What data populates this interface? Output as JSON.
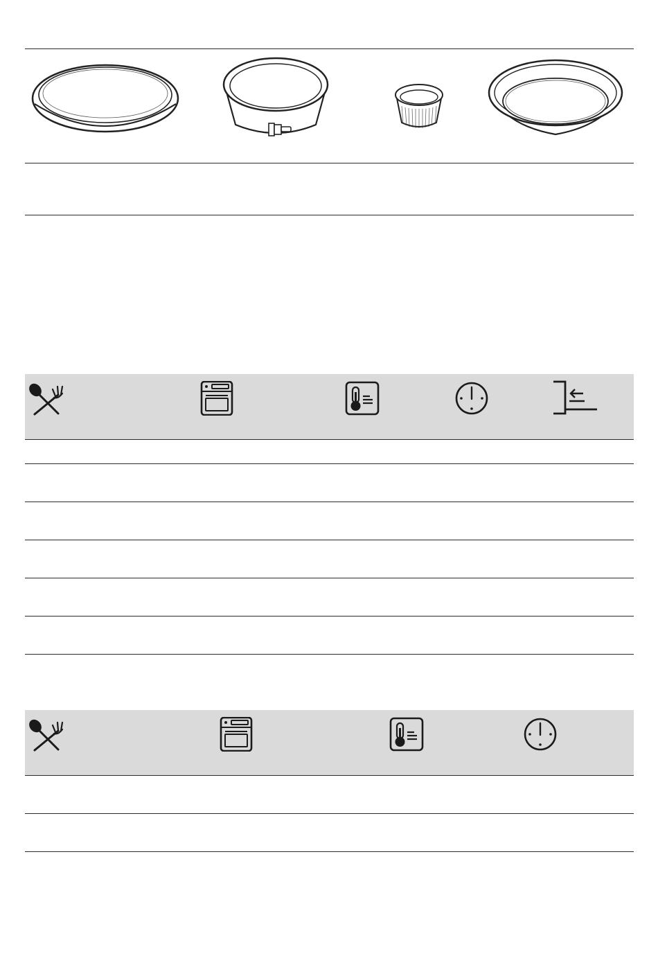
{
  "bakeware": {
    "items": [
      {
        "icon": "flat-pizza-pan-icon"
      },
      {
        "icon": "springform-cake-tin-icon"
      },
      {
        "icon": "ramekin-icon"
      },
      {
        "icon": "deep-flan-dish-icon"
      }
    ],
    "row_values": [
      "",
      "",
      "",
      ""
    ]
  },
  "table_1": {
    "header_icons": [
      "cutlery-icon",
      "oven-function-icon",
      "temperature-icon",
      "clock-icon",
      "shelf-level-icon"
    ],
    "rows": [
      [
        "",
        "",
        "",
        "",
        ""
      ],
      [
        "",
        "",
        "",
        "",
        ""
      ],
      [
        "",
        "",
        "",
        "",
        ""
      ],
      [
        "",
        "",
        "",
        "",
        ""
      ],
      [
        "",
        "",
        "",
        "",
        ""
      ],
      [
        "",
        "",
        "",
        "",
        ""
      ]
    ]
  },
  "table_2": {
    "header_icons": [
      "cutlery-icon",
      "oven-function-icon",
      "temperature-icon",
      "clock-icon"
    ],
    "rows": [
      [
        "",
        "",
        "",
        ""
      ],
      [
        "",
        "",
        "",
        ""
      ]
    ]
  }
}
